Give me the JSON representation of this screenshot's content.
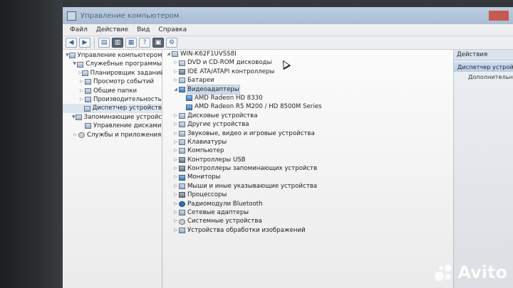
{
  "window": {
    "title": "Управление компьютером"
  },
  "menu": [
    "Файл",
    "Действие",
    "Вид",
    "Справка"
  ],
  "left_tree": [
    {
      "label": "Управление компьютером (л",
      "level": 0,
      "icon": "computer-icon",
      "exp": "▼"
    },
    {
      "label": "Служебные программы",
      "level": 1,
      "icon": "tools-icon",
      "exp": "▼"
    },
    {
      "label": "Планировщик заданий",
      "level": 2,
      "icon": "clock-icon",
      "exp": "▷"
    },
    {
      "label": "Просмотр событий",
      "level": 2,
      "icon": "event-viewer-icon",
      "exp": "▷"
    },
    {
      "label": "Общие папки",
      "level": 2,
      "icon": "shared-folder-icon",
      "exp": "▷"
    },
    {
      "label": "Производительность",
      "level": 2,
      "icon": "performance-icon",
      "exp": "▷"
    },
    {
      "label": "Диспетчер устройств",
      "level": 2,
      "icon": "device-manager-icon",
      "exp": "",
      "selected": true
    },
    {
      "label": "Запоминающие устройст",
      "level": 1,
      "icon": "storage-icon",
      "exp": "▼"
    },
    {
      "label": "Управление дисками",
      "level": 2,
      "icon": "disk-icon",
      "exp": ""
    },
    {
      "label": "Службы и приложения",
      "level": 1,
      "icon": "services-icon",
      "exp": "▷"
    }
  ],
  "device_tree": [
    {
      "label": "WIN-K62F1UVSS8I",
      "level": 0,
      "icon": "computer-icon",
      "exp": "◢"
    },
    {
      "label": "DVD и CD-ROM дисководы",
      "level": 1,
      "icon": "dvd-drive-icon",
      "exp": "▷"
    },
    {
      "label": "IDE ATA/ATAPI контроллеры",
      "level": 1,
      "icon": "ide-controller-icon",
      "exp": "▷"
    },
    {
      "label": "Батареи",
      "level": 1,
      "icon": "battery-icon",
      "exp": "▷"
    },
    {
      "label": "Видеоадаптеры",
      "level": 1,
      "icon": "display-adapter-icon",
      "exp": "◢",
      "highlight": true
    },
    {
      "label": "AMD Radeon HD 8330",
      "level": 2,
      "icon": "display-adapter-icon",
      "exp": ""
    },
    {
      "label": "AMD Radeon R5 M200 / HD 8500M Series",
      "level": 2,
      "icon": "display-adapter-icon",
      "exp": ""
    },
    {
      "label": "Дисковые устройства",
      "level": 1,
      "icon": "disk-drive-icon",
      "exp": "▷"
    },
    {
      "label": "Другие устройства",
      "level": 1,
      "icon": "other-devices-icon",
      "exp": "▷"
    },
    {
      "label": "Звуковые, видео и игровые устройства",
      "level": 1,
      "icon": "sound-icon",
      "exp": "▷"
    },
    {
      "label": "Клавиатуры",
      "level": 1,
      "icon": "keyboard-icon",
      "exp": "▷"
    },
    {
      "label": "Компьютер",
      "level": 1,
      "icon": "computer-icon",
      "exp": "▷"
    },
    {
      "label": "Контроллеры USB",
      "level": 1,
      "icon": "usb-icon",
      "exp": "▷"
    },
    {
      "label": "Контроллеры запоминающих устройств",
      "level": 1,
      "icon": "storage-controller-icon",
      "exp": "▷"
    },
    {
      "label": "Мониторы",
      "level": 1,
      "icon": "monitor-icon",
      "exp": "▷"
    },
    {
      "label": "Мыши и иные указывающие устройства",
      "level": 1,
      "icon": "mouse-icon",
      "exp": "▷"
    },
    {
      "label": "Процессоры",
      "level": 1,
      "icon": "processor-icon",
      "exp": "▷"
    },
    {
      "label": "Радиомодули Bluetooth",
      "level": 1,
      "icon": "bluetooth-icon",
      "exp": "▷"
    },
    {
      "label": "Сетевые адаптеры",
      "level": 1,
      "icon": "network-adapter-icon",
      "exp": "▷"
    },
    {
      "label": "Системные устройства",
      "level": 1,
      "icon": "system-devices-icon",
      "exp": "▷"
    },
    {
      "label": "Устройства обработки изображений",
      "level": 1,
      "icon": "imaging-device-icon",
      "exp": "▷"
    }
  ],
  "actions": {
    "header": "Действия",
    "selected": "Диспетчер устройств",
    "more": "Дополнительные"
  },
  "watermark": "Avito"
}
